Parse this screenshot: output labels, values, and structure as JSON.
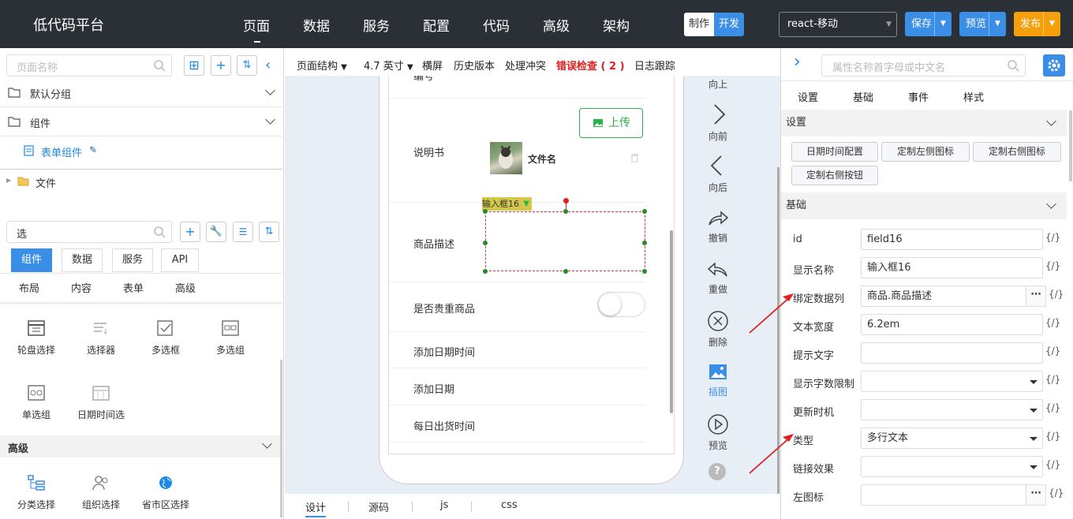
{
  "app": {
    "title": "低代码平台"
  },
  "nav": [
    "页面",
    "数据",
    "服务",
    "配置",
    "代码",
    "高级",
    "架构"
  ],
  "mode": {
    "make": "制作",
    "dev": "开发"
  },
  "platform": {
    "selected": "react-移动"
  },
  "actions": {
    "save": "保存",
    "preview": "预览",
    "publish": "发布"
  },
  "left": {
    "page_search_placeholder": "页面名称",
    "groups": [
      "默认分组",
      "组件"
    ],
    "child": "表单组件",
    "file": "文件",
    "comp_search_value": "选",
    "tabs": [
      "组件",
      "数据",
      "服务",
      "API"
    ],
    "subtabs": [
      "布局",
      "内容",
      "表单",
      "高级"
    ],
    "components_row1": [
      "轮盘选择",
      "选择器",
      "多选框",
      "多选组"
    ],
    "components_row2": [
      "单选组",
      "日期时间选"
    ],
    "advanced_header": "高级",
    "advanced": [
      "分类选择",
      "组织选择",
      "省市区选择"
    ]
  },
  "toolbar": {
    "structure": "页面结构",
    "size": "4.7 英寸",
    "landscape": "横屏",
    "history": "历史版本",
    "conflict": "处理冲突",
    "errors": "错误检查 ( 2 )",
    "log": "日志跟踪"
  },
  "form": {
    "top_label": "编号",
    "upload": "上传",
    "manual": "说明书",
    "file_name": "文件名",
    "selected_tag": "输入框16",
    "desc": "商品描述",
    "precious": "是否贵重商品",
    "add_datetime": "添加日期时间",
    "add_date": "添加日期",
    "daily_time": "每日出货时间"
  },
  "tools": [
    "向上",
    "向前",
    "向后",
    "撤销",
    "重做",
    "删除",
    "插图",
    "预览"
  ],
  "bottom_tabs": [
    "设计",
    "源码",
    "js",
    "css"
  ],
  "right": {
    "search_placeholder": "属性名称首字母或中文名",
    "tabs": [
      "设置",
      "基础",
      "事件",
      "样式"
    ],
    "settings_header": "设置",
    "settings_buttons": [
      "日期时间配置",
      "定制左侧图标",
      "定制右侧图标",
      "定制右侧按钮"
    ],
    "basic_header": "基础",
    "props": [
      {
        "label": "id",
        "value": "field16"
      },
      {
        "label": "显示名称",
        "value": "输入框16"
      },
      {
        "label": "绑定数据列",
        "value": "商品.商品描述"
      },
      {
        "label": "文本宽度",
        "value": "6.2em"
      },
      {
        "label": "提示文字",
        "value": ""
      },
      {
        "label": "显示字数限制",
        "value": ""
      },
      {
        "label": "更新时机",
        "value": ""
      },
      {
        "label": "类型",
        "value": "多行文本"
      },
      {
        "label": "链接效果",
        "value": ""
      },
      {
        "label": "左图标",
        "value": ""
      }
    ],
    "code_tag": "{/}"
  },
  "colors": {
    "topbar": "#2b2f36",
    "accent": "#1e88e5",
    "save": "#3a8ee6",
    "publish": "#f5a00a",
    "error": "#e02020",
    "green": "#2bb24c"
  }
}
